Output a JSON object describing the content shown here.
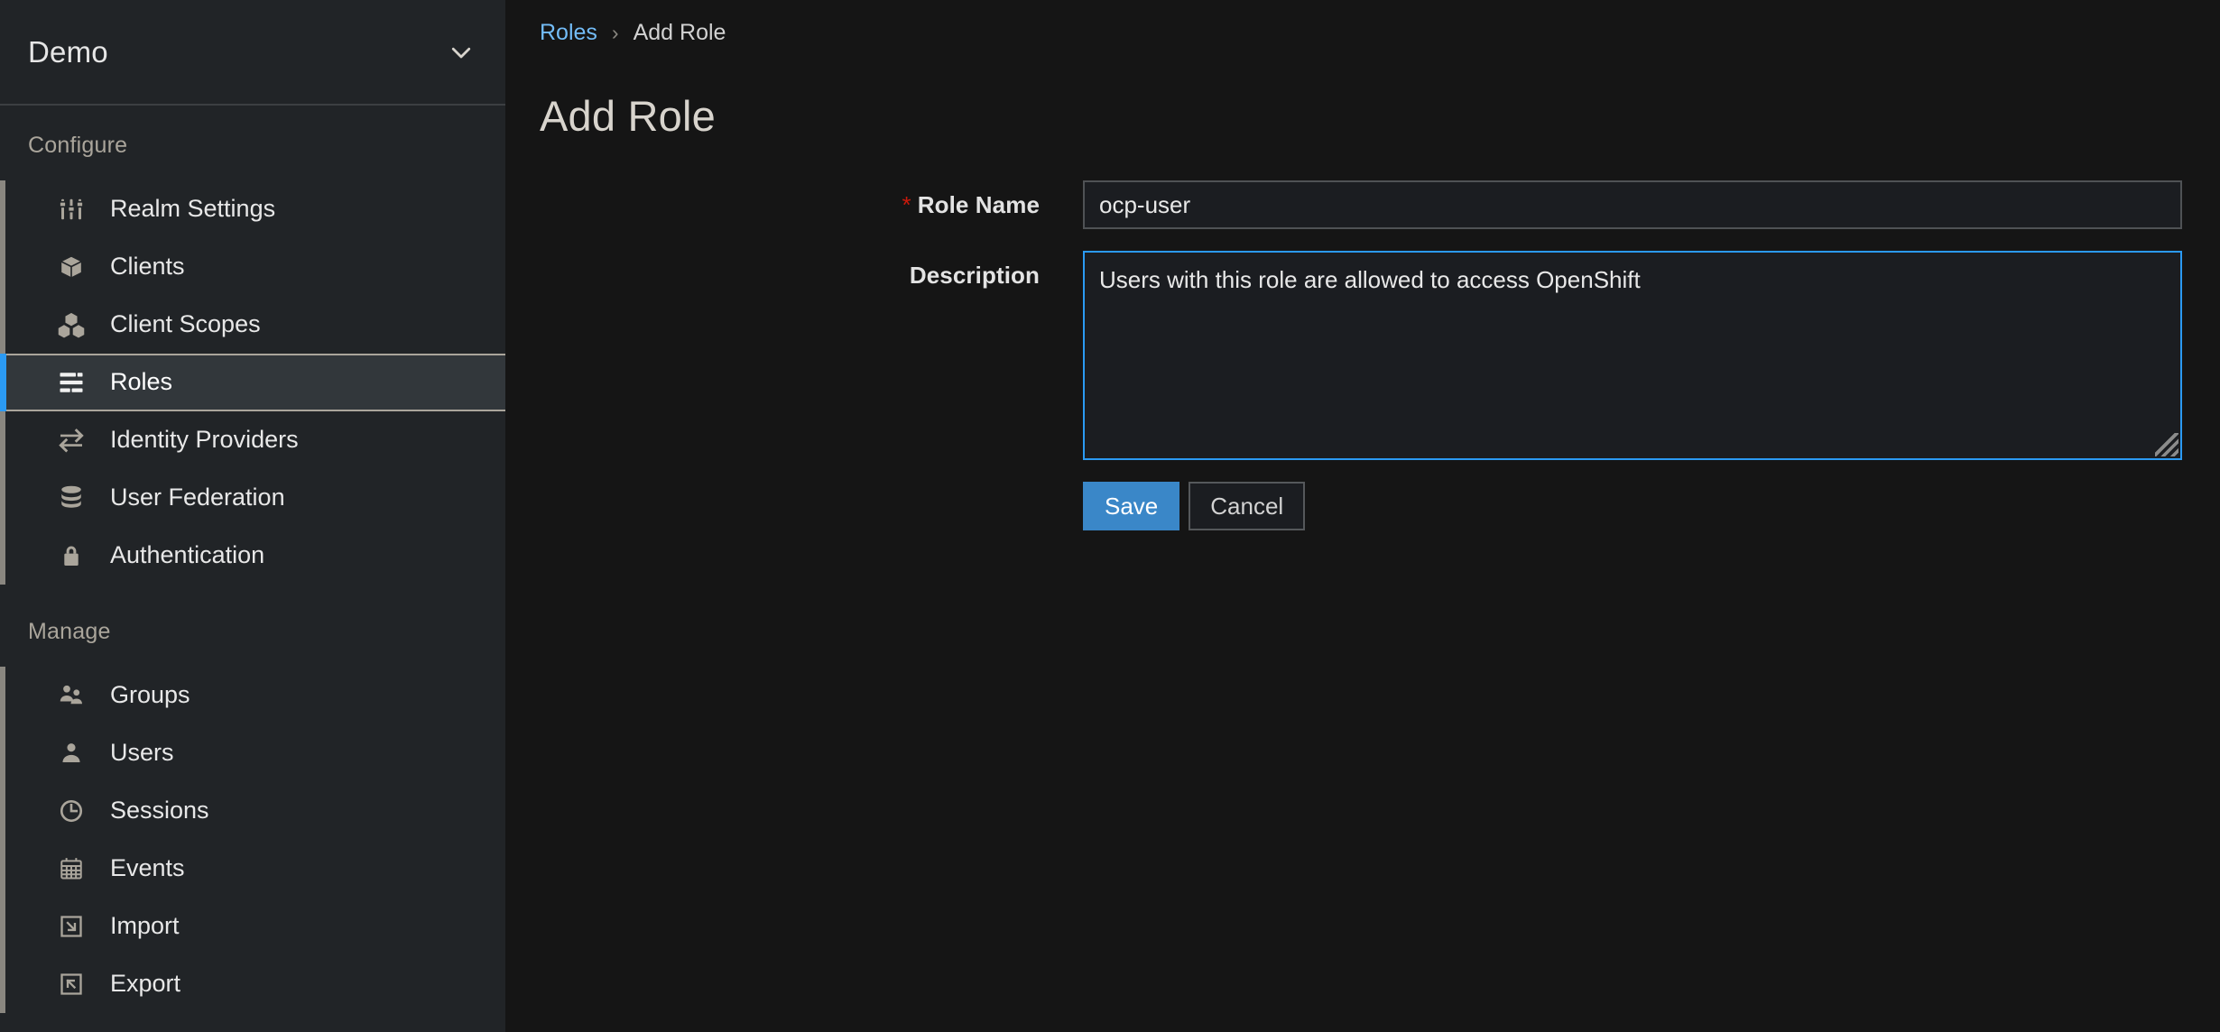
{
  "sidebar": {
    "realm": {
      "name": "Demo",
      "chevron_icon": "chevron-down-icon"
    },
    "sections": [
      {
        "title": "Configure",
        "items": [
          {
            "label": "Realm Settings",
            "icon": "sliders-icon",
            "selected": false
          },
          {
            "label": "Clients",
            "icon": "cube-icon",
            "selected": false
          },
          {
            "label": "Client Scopes",
            "icon": "cubes-icon",
            "selected": false
          },
          {
            "label": "Roles",
            "icon": "list-rows-icon",
            "selected": true
          },
          {
            "label": "Identity Providers",
            "icon": "exchange-arrows-icon",
            "selected": false
          },
          {
            "label": "User Federation",
            "icon": "database-icon",
            "selected": false
          },
          {
            "label": "Authentication",
            "icon": "lock-icon",
            "selected": false
          }
        ]
      },
      {
        "title": "Manage",
        "items": [
          {
            "label": "Groups",
            "icon": "users-group-icon",
            "selected": false
          },
          {
            "label": "Users",
            "icon": "user-icon",
            "selected": false
          },
          {
            "label": "Sessions",
            "icon": "clock-icon",
            "selected": false
          },
          {
            "label": "Events",
            "icon": "calendar-icon",
            "selected": false
          },
          {
            "label": "Import",
            "icon": "import-arrow-icon",
            "selected": false
          },
          {
            "label": "Export",
            "icon": "export-arrow-icon",
            "selected": false
          }
        ]
      }
    ]
  },
  "breadcrumb": {
    "parent": "Roles",
    "separator": "›",
    "current": "Add Role"
  },
  "page": {
    "title": "Add Role"
  },
  "form": {
    "role_name": {
      "label": "Role Name",
      "required_marker": "*",
      "value": "ocp-user",
      "placeholder": ""
    },
    "description": {
      "label": "Description",
      "value": "Users with this role are allowed to access OpenShift",
      "placeholder": ""
    },
    "save_label": "Save",
    "cancel_label": "Cancel"
  },
  "colors": {
    "accent_blue": "#2b9af3",
    "link_blue": "#73bcf7",
    "primary_button": "#3a87c8",
    "required_red": "#c9190b",
    "sidebar_bg": "#212427",
    "main_bg": "#151515",
    "selected_item_bg": "#32373b"
  }
}
